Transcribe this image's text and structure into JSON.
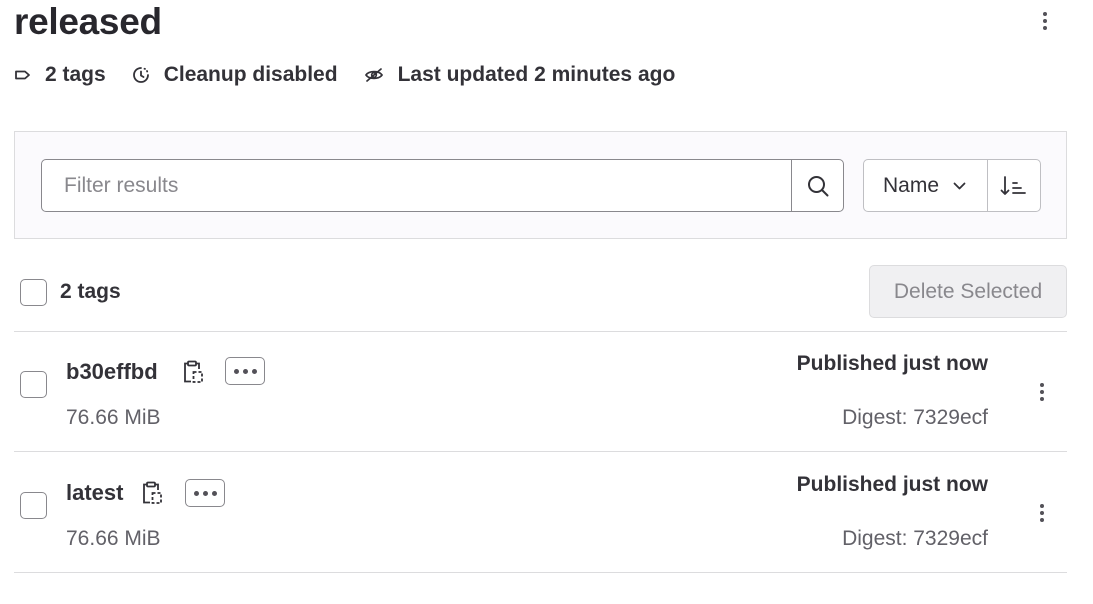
{
  "header": {
    "title": "released",
    "tags_count": "2 tags",
    "cleanup_status": "Cleanup disabled",
    "last_updated": "Last updated 2 minutes ago"
  },
  "filter": {
    "placeholder": "Filter results",
    "sort_field": "Name"
  },
  "list": {
    "count_label": "2 tags",
    "delete_label": "Delete Selected",
    "rows": [
      {
        "name": "b30effbd",
        "size": "76.66 MiB",
        "published": "Published just now",
        "digest": "Digest: 7329ecf"
      },
      {
        "name": "latest",
        "size": "76.66 MiB",
        "published": "Published just now",
        "digest": "Digest: 7329ecf"
      }
    ]
  },
  "icons": {
    "tag": "tag-icon",
    "cleanup": "clock-icon",
    "updated": "eye-slash-icon",
    "search": "search-icon",
    "sort_dropdown": "chevron-down-icon",
    "sort_direction": "sort-ascending-icon",
    "copy": "clipboard-icon",
    "more": "ellipsis-icon",
    "kebab": "kebab-icon"
  },
  "colors": {
    "text": "#333238",
    "muted": "#626168",
    "border": "#dcdcde",
    "disabled_bg": "#f0f0f2"
  }
}
